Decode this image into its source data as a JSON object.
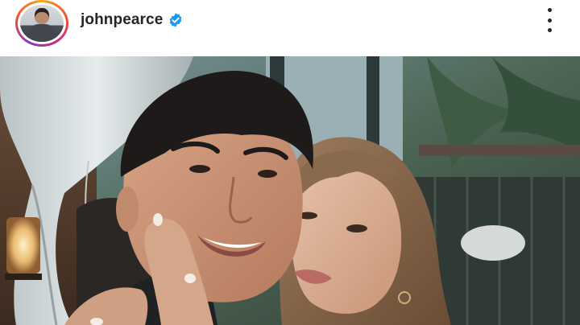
{
  "post": {
    "username": "johnpearce",
    "verified": true,
    "more_icon": "more-vertical-icon",
    "verified_icon": "verified-badge-icon",
    "story_ring_colors": [
      "#f9a51f",
      "#f2542d",
      "#c7268c",
      "#8a3ab9"
    ],
    "verified_color": "#1d9bf0"
  }
}
